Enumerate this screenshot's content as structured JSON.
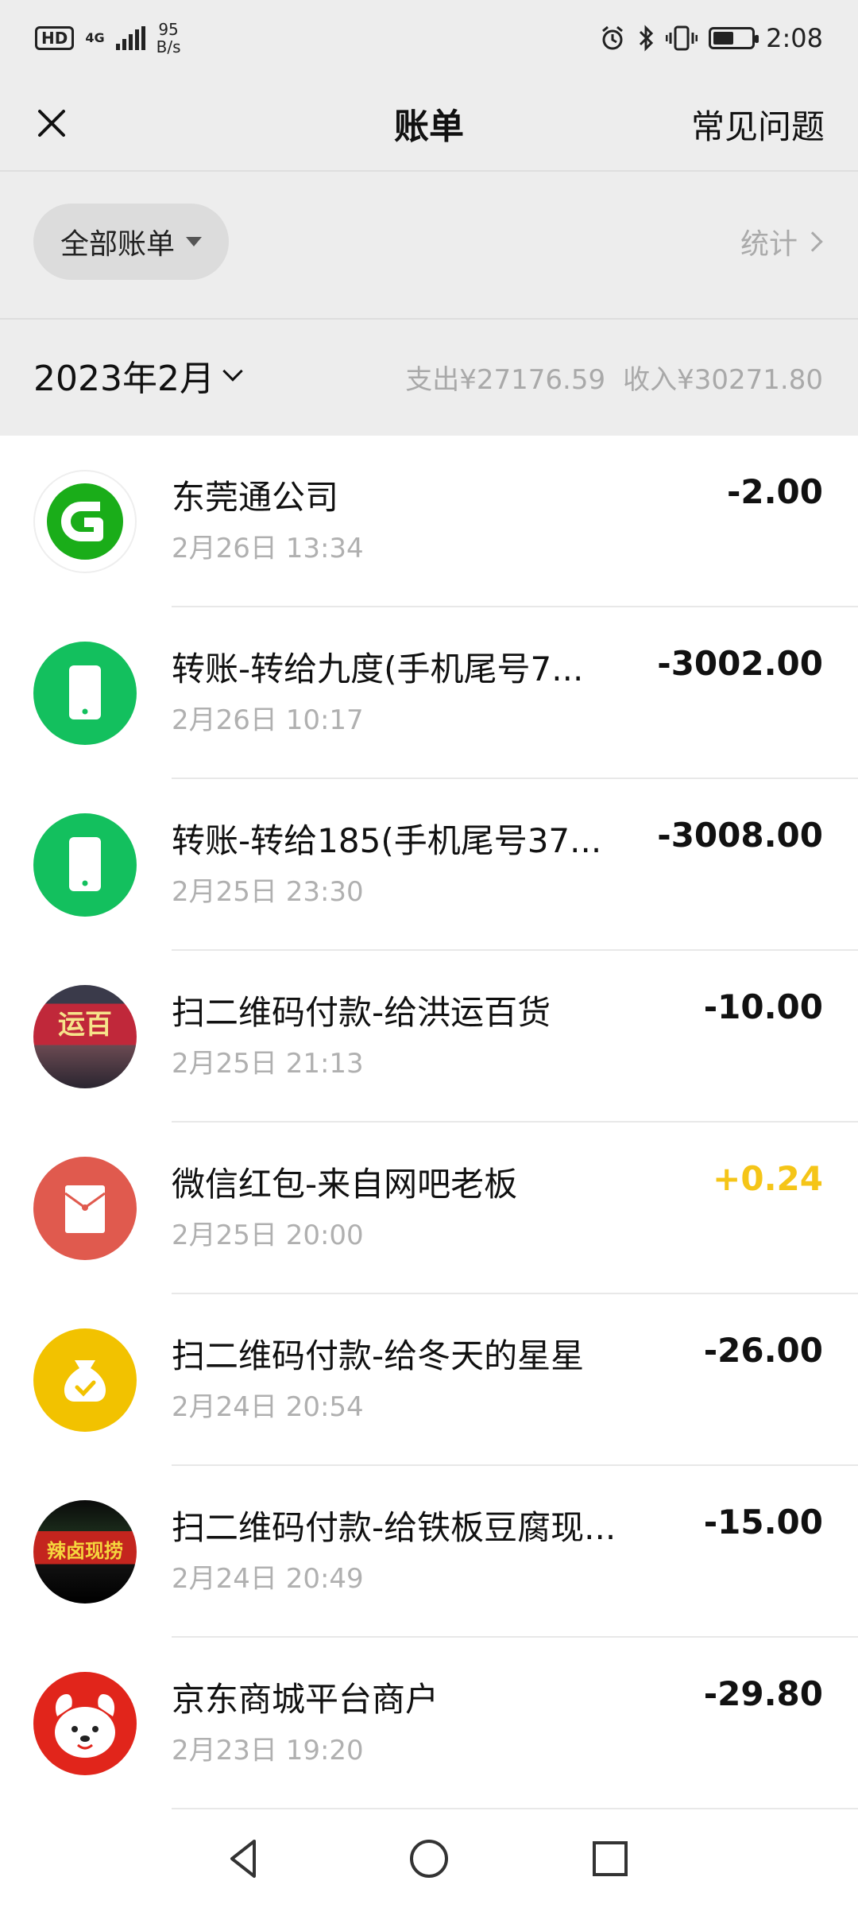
{
  "status_bar": {
    "hd": "HD",
    "network": "4G",
    "speed_value": "95",
    "speed_unit": "B/s",
    "time": "2:08",
    "icons": [
      "alarm-icon",
      "bluetooth-icon",
      "vibrate-icon",
      "battery-icon"
    ]
  },
  "header": {
    "title": "账单",
    "faq": "常见问题",
    "close_icon": "close-icon"
  },
  "filter": {
    "pill_label": "全部账单",
    "stats_label": "统计"
  },
  "month_summary": {
    "month": "2023年2月",
    "expense": "支出¥27176.59",
    "income": "收入¥30271.80"
  },
  "transactions": [
    {
      "name": "东莞通公司",
      "time": "2月26日 13:34",
      "amount": "-2.00",
      "avatar": "dongguantong-logo"
    },
    {
      "name": "转账-转给九度(手机尾号7...",
      "time": "2月26日 10:17",
      "amount": "-3002.00",
      "avatar": "transfer-phone-icon"
    },
    {
      "name": "转账-转给185(手机尾号37...",
      "time": "2月25日 23:30",
      "amount": "-3008.00",
      "avatar": "transfer-phone-icon"
    },
    {
      "name": "扫二维码付款-给洪运百货",
      "time": "2月25日 21:13",
      "amount": "-10.00",
      "avatar": "store-photo",
      "avatar_text": "运百"
    },
    {
      "name": "微信红包-来自网吧老板",
      "time": "2月25日 20:00",
      "amount": "+0.24",
      "avatar": "red-packet-icon"
    },
    {
      "name": "扫二维码付款-给冬天的星星",
      "time": "2月24日 20:54",
      "amount": "-26.00",
      "avatar": "money-bag-icon"
    },
    {
      "name": "扫二维码付款-给铁板豆腐现...",
      "time": "2月24日 20:49",
      "amount": "-15.00",
      "avatar": "night-store-photo",
      "avatar_text": "辣卤现捞"
    },
    {
      "name": "京东商城平台商户",
      "time": "2月23日 19:20",
      "amount": "-29.80",
      "avatar": "jd-dog-logo"
    }
  ],
  "colors": {
    "green": "#1aad19",
    "red_packet": "#e05a4e",
    "yellow": "#f2c200",
    "income": "#f5c518"
  },
  "nav": [
    "back-icon",
    "home-icon",
    "recents-icon"
  ]
}
